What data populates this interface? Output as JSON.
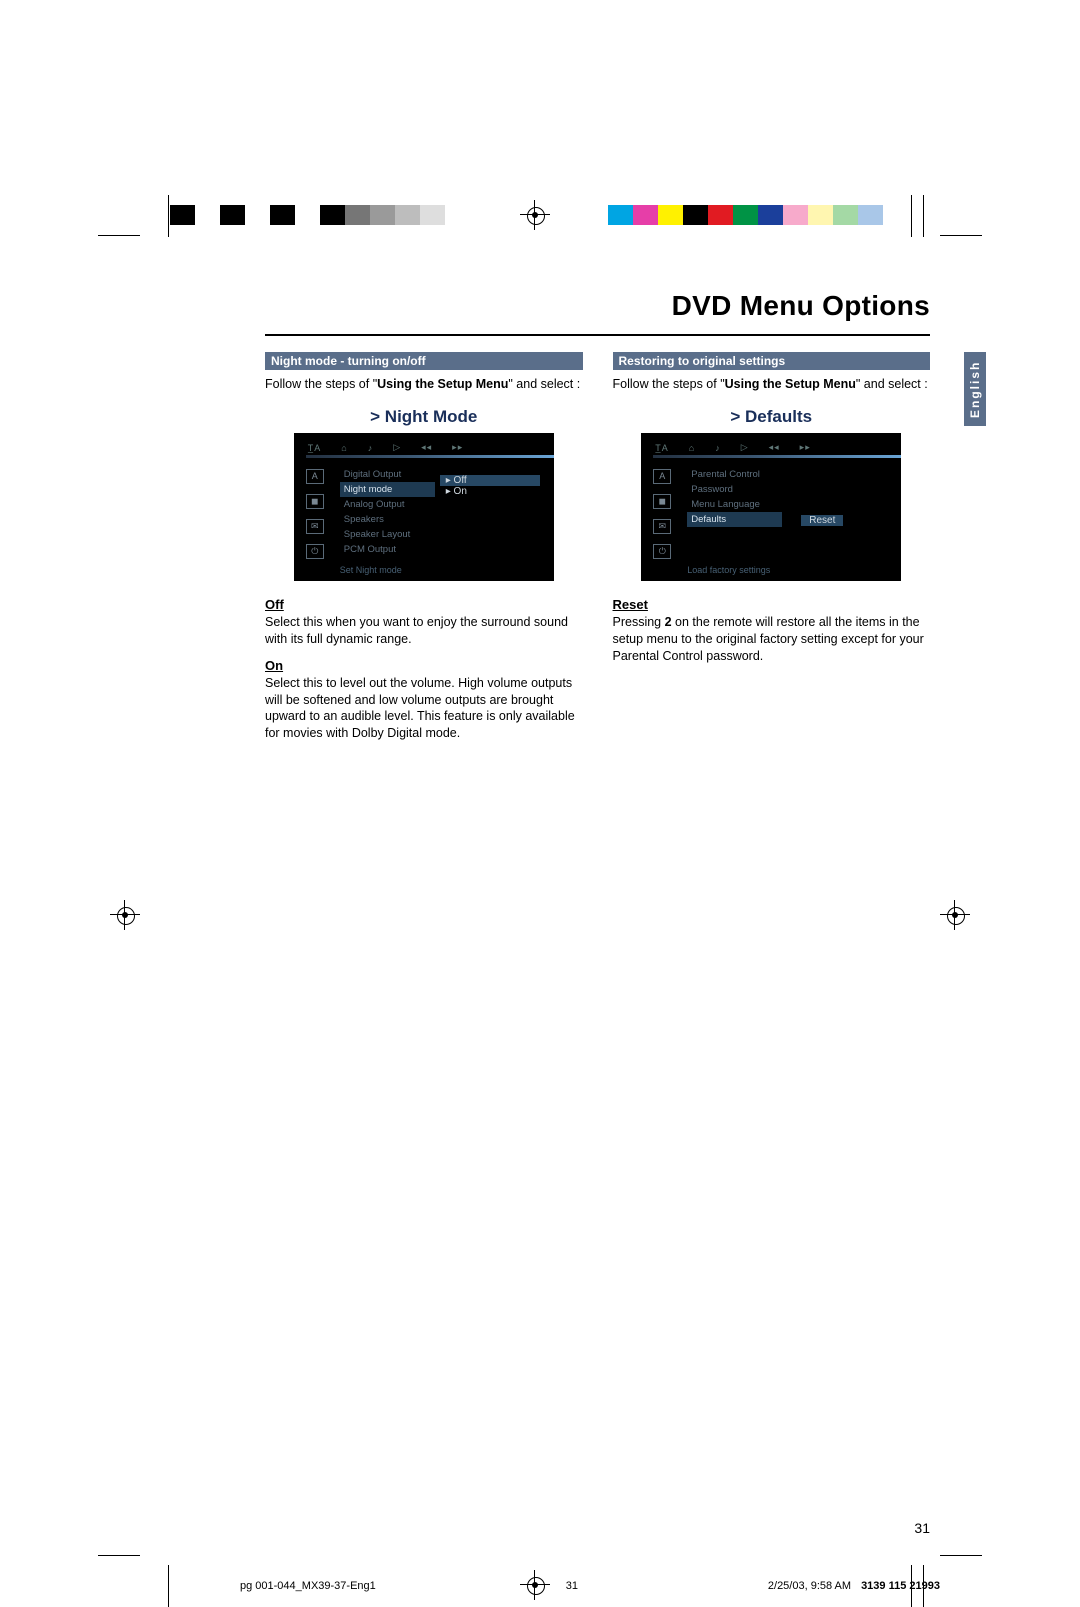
{
  "title": "DVD Menu Options",
  "language_tab": "English",
  "left": {
    "bar": "Night mode - turning on/off",
    "intro_a": "Follow the steps of \"",
    "intro_b": "Using the Setup Menu",
    "intro_c": "\" and select :",
    "osd_title": ">  Night Mode",
    "osd_items": [
      "Digital Output",
      "Night mode",
      "Analog Output",
      "Speakers",
      "Speaker Layout",
      "PCM Output"
    ],
    "osd_selected_index": 1,
    "osd_options": [
      "Off",
      "On"
    ],
    "osd_option_selected": 0,
    "osd_hint": "Set Night mode",
    "off_label": "Off",
    "off_text": "Select this when you want to enjoy the surround sound with its full dynamic range.",
    "on_label": "On",
    "on_text": "Select this to level out the volume.  High volume outputs will be softened and low volume outputs are brought upward to an audible level.  This feature is only available for movies with Dolby Digital mode."
  },
  "right": {
    "bar": "Restoring to original settings",
    "intro_a": "Follow the steps of \"",
    "intro_b": "Using the Setup Menu",
    "intro_c": "\" and select :",
    "osd_title": ">  Defaults",
    "osd_items": [
      "Parental Control",
      "Password",
      "Menu Language",
      "Defaults"
    ],
    "osd_selected_index": 3,
    "osd_option": "Reset",
    "osd_hint": "Load factory settings",
    "reset_label": "Reset",
    "reset_text_a": "Pressing ",
    "reset_text_key": "2",
    "reset_text_b": " on the remote will restore all the items in the setup menu to the original factory setting except for your Parental Control password."
  },
  "page_number": "31",
  "footer": {
    "file": "pg 001-044_MX39-37-Eng1",
    "page": "31",
    "date": "2/25/03, 9:58 AM",
    "code": "3139 115 21993"
  },
  "colorbars": {
    "left": [
      "#000",
      "#fff",
      "#000",
      "#fff",
      "#000",
      "#fff",
      "#000",
      "#767676",
      "#9a9a9a",
      "#bdbdbd",
      "#dedede",
      "#fff"
    ],
    "right": [
      "#00a5e3",
      "#e63ea8",
      "#fff100",
      "#000",
      "#e11b22",
      "#009345",
      "#1b3f9b",
      "#f7aacb",
      "#fff6b0",
      "#a4d9a5",
      "#a9c7e8",
      "#fff"
    ]
  }
}
